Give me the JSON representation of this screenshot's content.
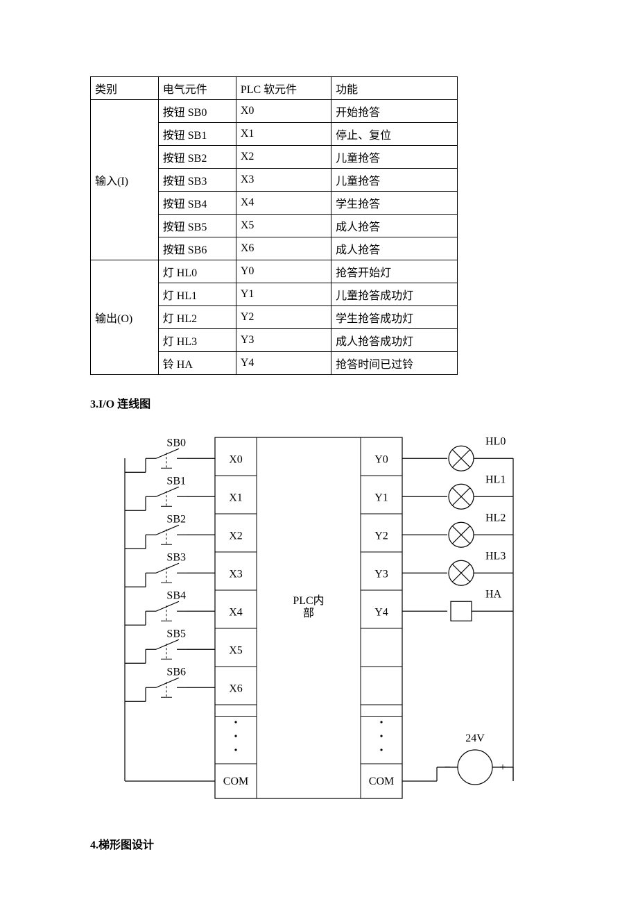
{
  "table": {
    "headers": [
      "类别",
      "电气元件",
      "PLC 软元件",
      "功能"
    ],
    "groups": [
      {
        "category": "输入(I)",
        "rows": [
          {
            "comp": "按钮 SB0",
            "plc": "X0",
            "func": "开始抢答"
          },
          {
            "comp": "按钮 SB1",
            "plc": "X1",
            "func": "停止、复位"
          },
          {
            "comp": "按钮 SB2",
            "plc": "X2",
            "func": "儿童抢答"
          },
          {
            "comp": "按钮 SB3",
            "plc": "X3",
            "func": "儿童抢答"
          },
          {
            "comp": "按钮 SB4",
            "plc": "X4",
            "func": "学生抢答"
          },
          {
            "comp": "按钮 SB5",
            "plc": "X5",
            "func": "成人抢答"
          },
          {
            "comp": "按钮 SB6",
            "plc": "X6",
            "func": "成人抢答"
          }
        ]
      },
      {
        "category": "输出(O)",
        "rows": [
          {
            "comp": "灯 HL0",
            "plc": "Y0",
            "func": "抢答开始灯"
          },
          {
            "comp": "灯 HL1",
            "plc": "Y1",
            "func": "儿童抢答成功灯"
          },
          {
            "comp": "灯 HL2",
            "plc": "Y2",
            "func": "学生抢答成功灯"
          },
          {
            "comp": "灯 HL3",
            "plc": "Y3",
            "func": "成人抢答成功灯"
          },
          {
            "comp": "铃 HA",
            "plc": "Y4",
            "func": "抢答时间已过铃"
          }
        ]
      }
    ]
  },
  "heading_io": "3.I/O 连线图",
  "heading_ladder": "4.梯形图设计",
  "diagram": {
    "center": "PLC内部",
    "com": "COM",
    "inputs": [
      {
        "btn": "SB0",
        "term": "X0"
      },
      {
        "btn": "SB1",
        "term": "X1"
      },
      {
        "btn": "SB2",
        "term": "X2"
      },
      {
        "btn": "SB3",
        "term": "X3"
      },
      {
        "btn": "SB4",
        "term": "X4"
      },
      {
        "btn": "SB5",
        "term": "X5"
      },
      {
        "btn": "SB6",
        "term": "X6"
      }
    ],
    "outputs": [
      {
        "term": "Y0",
        "load": "HL0",
        "type": "lamp"
      },
      {
        "term": "Y1",
        "load": "HL1",
        "type": "lamp"
      },
      {
        "term": "Y2",
        "load": "HL2",
        "type": "lamp"
      },
      {
        "term": "Y3",
        "load": "HL3",
        "type": "lamp"
      },
      {
        "term": "Y4",
        "load": "HA",
        "type": "box"
      }
    ],
    "supply": {
      "label": "24V",
      "minus": "−",
      "plus": "+"
    }
  }
}
